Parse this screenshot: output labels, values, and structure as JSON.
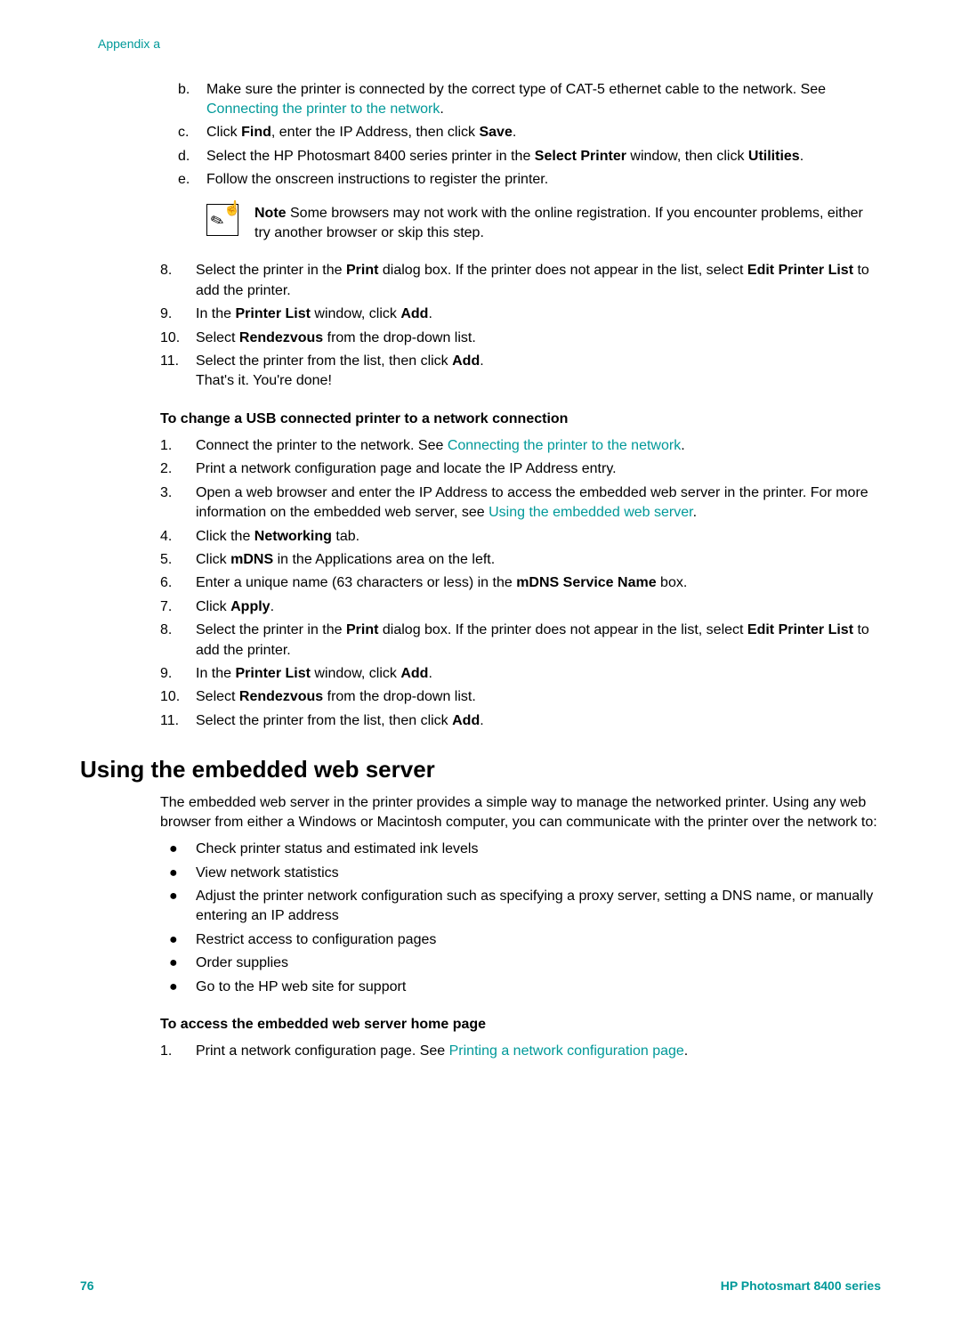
{
  "header": {
    "appendix": "Appendix a"
  },
  "upperList": {
    "b": {
      "marker": "b.",
      "text1": "Make sure the printer is connected by the correct type of CAT-5 ethernet cable to the network. See ",
      "link": "Connecting the printer to the network",
      "text2": "."
    },
    "c": {
      "marker": "c.",
      "text1": "Click ",
      "bold1": "Find",
      "text2": ", enter the IP Address, then click ",
      "bold2": "Save",
      "text3": "."
    },
    "d": {
      "marker": "d.",
      "text1": "Select the HP Photosmart 8400 series printer in the ",
      "bold1": "Select Printer",
      "text2": " window, then click ",
      "bold2": "Utilities",
      "text3": "."
    },
    "e": {
      "marker": "e.",
      "text": "Follow the onscreen instructions to register the printer."
    }
  },
  "note": {
    "label": "Note",
    "text": "   Some browsers may not work with the online registration. If you encounter problems, either try another browser or skip this step."
  },
  "mainList": {
    "8": {
      "marker": "8.",
      "text1": "Select the printer in the ",
      "bold1": "Print",
      "text2": " dialog box. If the printer does not appear in the list, select ",
      "bold2": "Edit Printer List",
      "text3": " to add the printer."
    },
    "9": {
      "marker": "9.",
      "text1": "In the ",
      "bold1": "Printer List",
      "text2": " window, click ",
      "bold2": "Add",
      "text3": "."
    },
    "10": {
      "marker": "10.",
      "text1": "Select ",
      "bold1": "Rendezvous",
      "text2": " from the drop-down list."
    },
    "11": {
      "marker": "11.",
      "text1": "Select the printer from the list, then click ",
      "bold1": "Add",
      "text2": ".",
      "text3": "That's it. You're done!"
    }
  },
  "section1": {
    "heading": "To change a USB connected printer to a network connection",
    "1": {
      "marker": "1.",
      "text1": "Connect the printer to the network. See ",
      "link": "Connecting the printer to the network",
      "text2": "."
    },
    "2": {
      "marker": "2.",
      "text": "Print a network configuration page and locate the IP Address entry."
    },
    "3": {
      "marker": "3.",
      "text1": "Open a web browser and enter the IP Address to access the embedded web server in the printer. For more information on the embedded web server, see ",
      "link": "Using the embedded web server",
      "text2": "."
    },
    "4": {
      "marker": "4.",
      "text1": "Click the ",
      "bold1": "Networking",
      "text2": " tab."
    },
    "5": {
      "marker": "5.",
      "text1": "Click ",
      "bold1": "mDNS",
      "text2": " in the Applications area on the left."
    },
    "6": {
      "marker": "6.",
      "text1": "Enter a unique name (63 characters or less) in the ",
      "bold1": "mDNS Service Name",
      "text2": " box."
    },
    "7": {
      "marker": "7.",
      "text1": "Click ",
      "bold1": "Apply",
      "text2": "."
    },
    "8": {
      "marker": "8.",
      "text1": "Select the printer in the ",
      "bold1": "Print",
      "text2": " dialog box. If the printer does not appear in the list, select ",
      "bold2": "Edit Printer List",
      "text3": " to add the printer."
    },
    "9": {
      "marker": "9.",
      "text1": "In the ",
      "bold1": "Printer List",
      "text2": " window, click ",
      "bold2": "Add",
      "text3": "."
    },
    "10": {
      "marker": "10.",
      "text1": "Select ",
      "bold1": "Rendezvous",
      "text2": " from the drop-down list."
    },
    "11": {
      "marker": "11.",
      "text1": "Select the printer from the list, then click ",
      "bold1": "Add",
      "text2": "."
    }
  },
  "section2": {
    "heading": "Using the embedded web server",
    "intro": "The embedded web server in the printer provides a simple way to manage the networked printer. Using any web browser from either a Windows or Macintosh computer, you can communicate with the printer over the network to:",
    "bullets": [
      "Check printer status and estimated ink levels",
      "View network statistics",
      "Adjust the printer network configuration such as specifying a proxy server, setting a DNS name, or manually entering an IP address",
      "Restrict access to configuration pages",
      "Order supplies",
      "Go to the HP web site for support"
    ],
    "subheading": "To access the embedded web server home page",
    "1": {
      "marker": "1.",
      "text1": "Print a network configuration page. See ",
      "link": "Printing a network configuration page",
      "text2": "."
    }
  },
  "footer": {
    "page": "76",
    "series": "HP Photosmart 8400 series"
  }
}
